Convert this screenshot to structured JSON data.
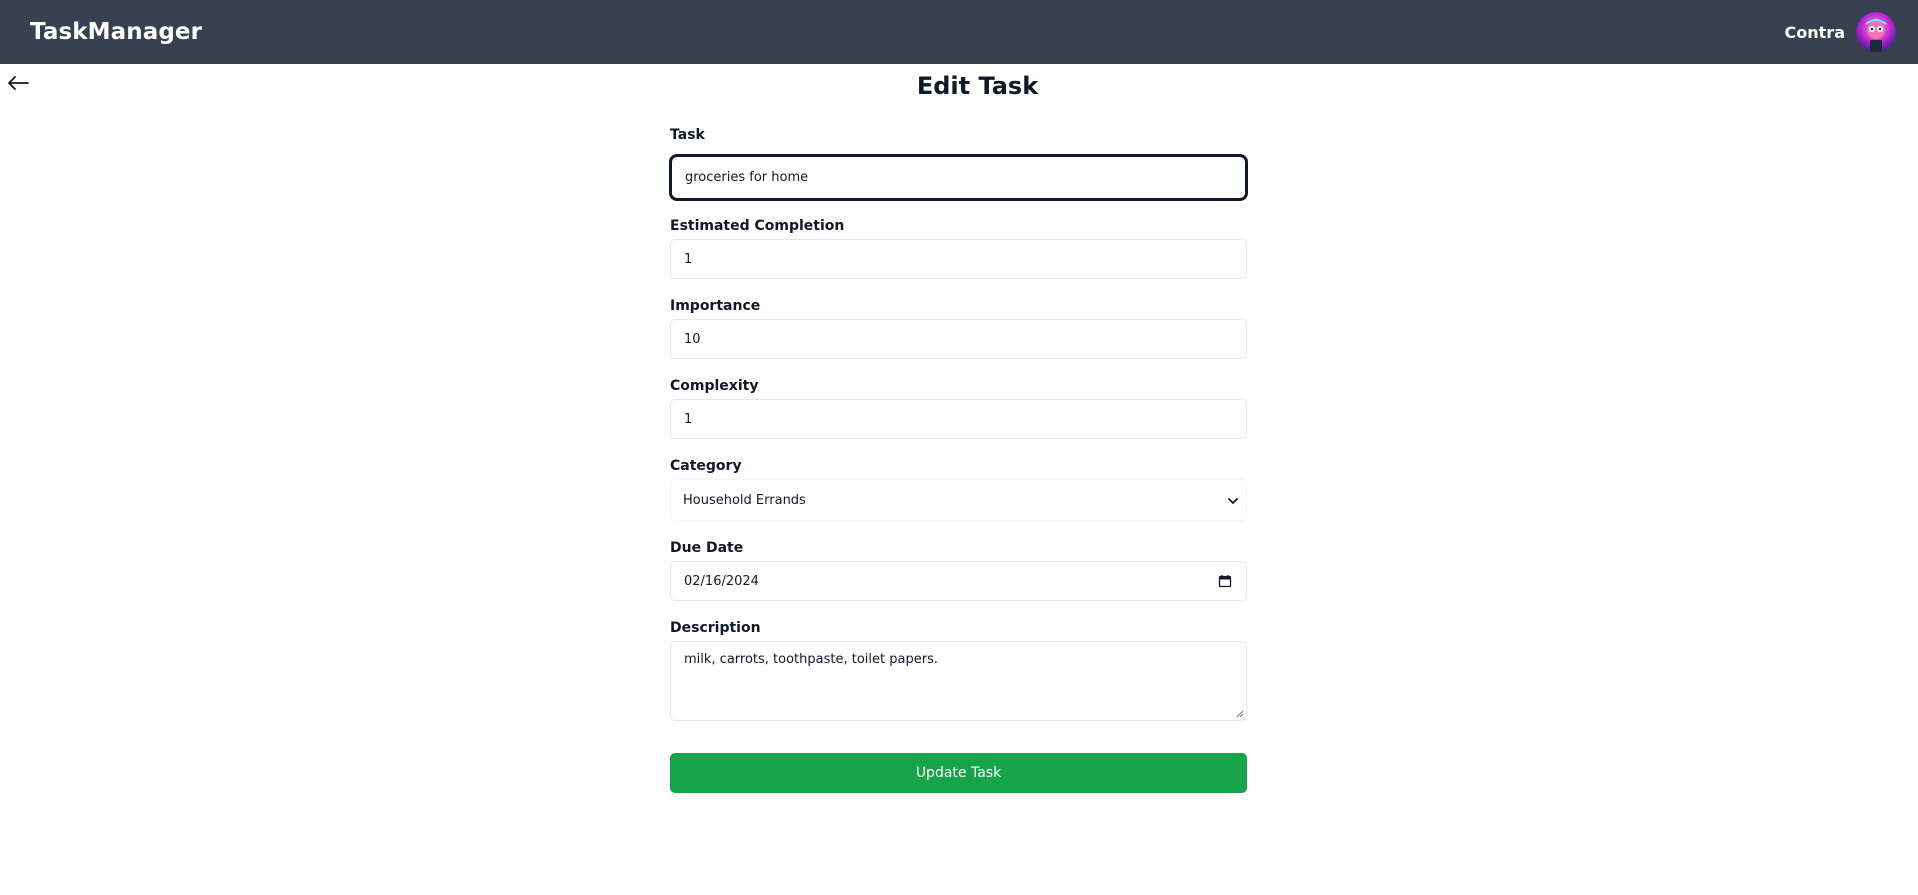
{
  "header": {
    "brand": "TaskManager",
    "username": "Contra",
    "avatar_icon": "avatar-cartoon-icon"
  },
  "page": {
    "title": "Edit Task",
    "back_icon": "arrow-left-icon"
  },
  "form": {
    "task": {
      "label": "Task",
      "value": "groceries for home"
    },
    "estimated_completion": {
      "label": "Estimated Completion",
      "value": "1"
    },
    "importance": {
      "label": "Importance",
      "value": "10"
    },
    "complexity": {
      "label": "Complexity",
      "value": "1"
    },
    "category": {
      "label": "Category",
      "value": "Household Errands"
    },
    "due_date": {
      "label": "Due Date",
      "value": "02/16/2024"
    },
    "description": {
      "label": "Description",
      "value": "milk, carrots, toothpaste, toilet papers."
    },
    "submit_label": "Update Task"
  },
  "colors": {
    "header_bg": "#374151",
    "primary_button": "#16a34a"
  }
}
